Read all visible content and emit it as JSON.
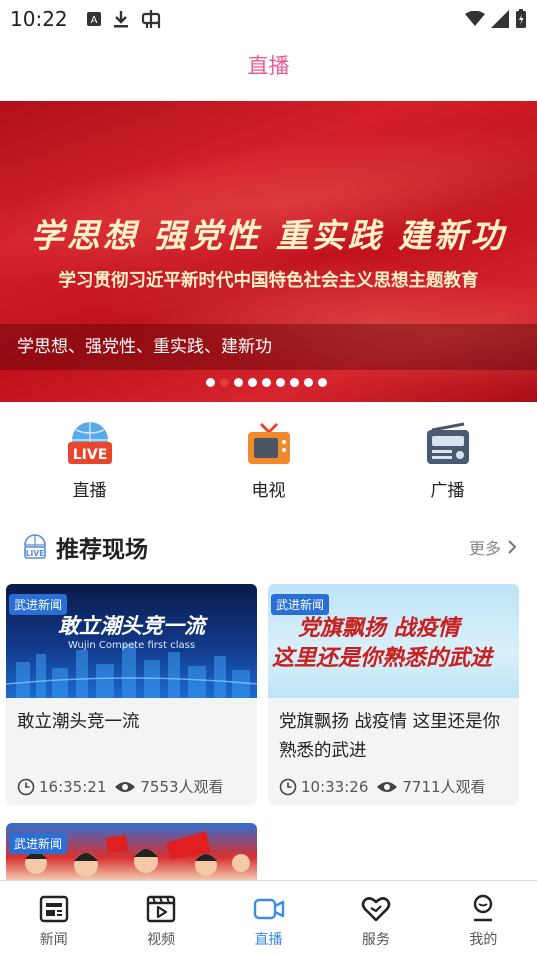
{
  "status_bar": {
    "time": "10:22"
  },
  "header": {
    "title": "直播"
  },
  "banner": {
    "headline": "学思想 强党性 重实践 建新功",
    "subline": "学习贯彻习近平新时代中国特色社会主义思想主题教育",
    "caption": "学思想、强党性、重实践、建新功",
    "total_slides": 9,
    "active_slide": 2
  },
  "quick_links": [
    {
      "label": "直播",
      "icon": "live-icon"
    },
    {
      "label": "电视",
      "icon": "tv-icon"
    },
    {
      "label": "广播",
      "icon": "radio-icon"
    }
  ],
  "section": {
    "title": "推荐现场",
    "more": "更多"
  },
  "cards": [
    {
      "tag": "武进新闻",
      "thumb_title": "敢立潮头竞一流",
      "thumb_en": "Wujin Compete first class",
      "title": "敢立潮头竞一流",
      "time": "16:35:21",
      "views": "7553人观看"
    },
    {
      "tag": "武进新闻",
      "thumb_line1": "党旗飘扬 战疫情",
      "thumb_line2": "这里还是你熟悉的武进",
      "title": "党旗飘扬 战疫情 这里还是你熟悉的武进",
      "time": "10:33:26",
      "views": "7711人观看"
    },
    {
      "tag": "武进新闻"
    }
  ],
  "tabbar": {
    "items": [
      {
        "label": "新闻"
      },
      {
        "label": "视频"
      },
      {
        "label": "直播"
      },
      {
        "label": "服务"
      },
      {
        "label": "我的"
      }
    ],
    "active": "直播",
    "active_color": "#3b8ee8"
  }
}
